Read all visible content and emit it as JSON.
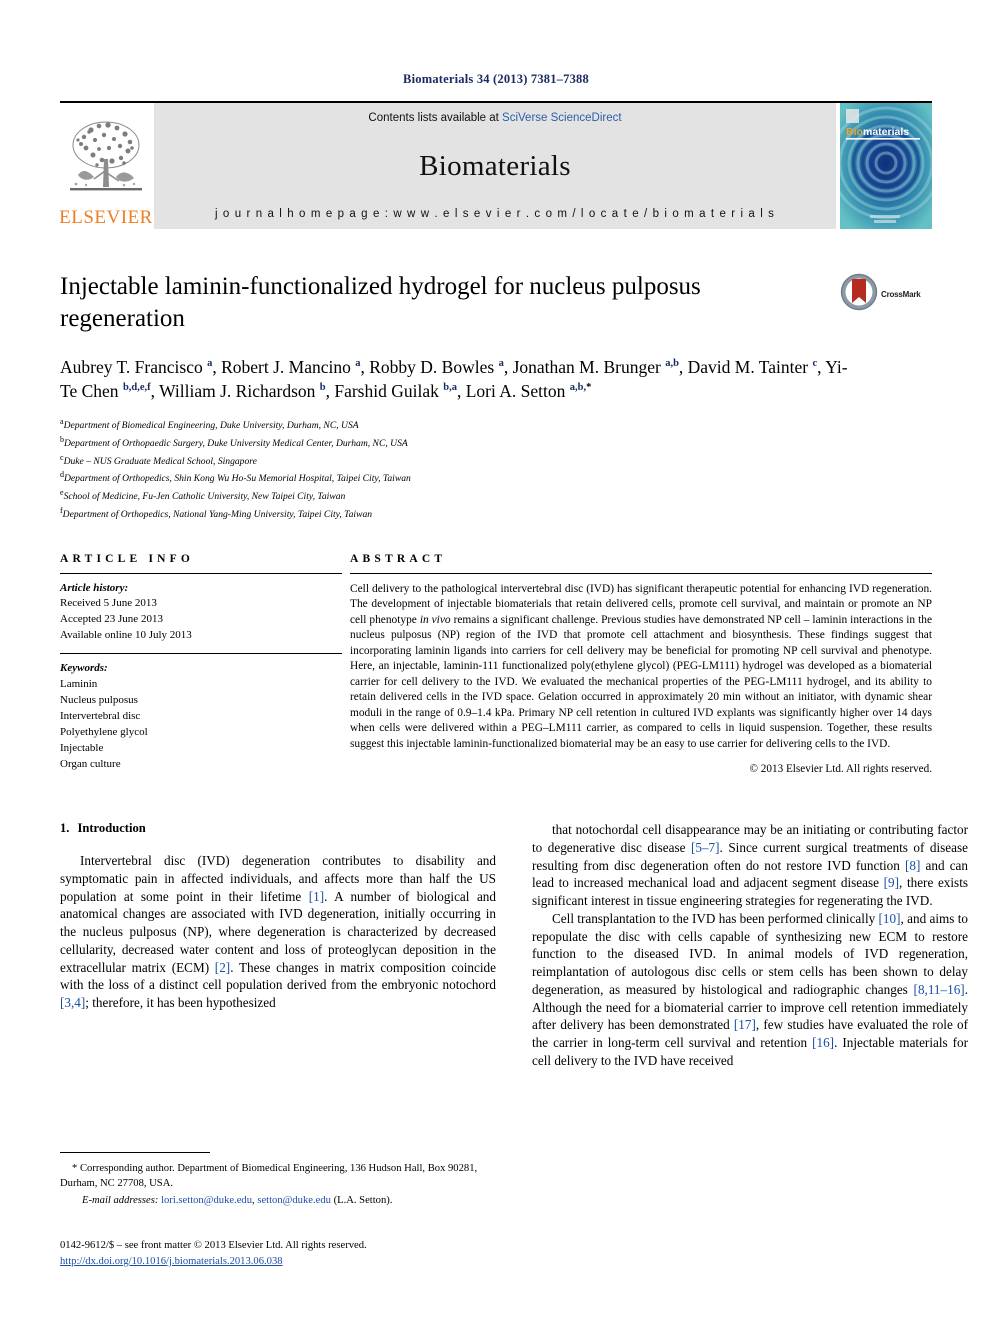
{
  "running_head": "Biomaterials 34 (2013) 7381–7388",
  "masthead": {
    "publisher_word": "ELSEVIER",
    "contents_prefix": "Contents lists available at ",
    "contents_link": "SciVerse ScienceDirect",
    "journal_title": "Biomaterials",
    "homepage": "j o u r n a l   h o m e p a g e :   w w w . e l s e v i e r . c o m / l o c a t e / b i o m a t e r i a l s",
    "cover_title_a": "Bio",
    "cover_title_b": "materials"
  },
  "article": {
    "title": "Injectable laminin-functionalized hydrogel for nucleus pulposus regeneration",
    "crossmark_label": "CrossMark",
    "authors_html": "Aubrey T. Francisco <sup>a</sup>, Robert J. Mancino <sup>a</sup>, Robby D. Bowles <sup>a</sup>, Jonathan M. Brunger <sup>a,b</sup>, David M. Tainter <sup>c</sup>, Yi-Te Chen <sup>b,d,e,f</sup>, William J. Richardson <sup>b</sup>, Farshid Guilak <sup>b,a</sup>, Lori A. Setton <sup>a,b,</sup><sup class=\"corr\">*</sup>",
    "affiliations": [
      {
        "mark": "a",
        "text": "Department of Biomedical Engineering, Duke University, Durham, NC, USA"
      },
      {
        "mark": "b",
        "text": "Department of Orthopaedic Surgery, Duke University Medical Center, Durham, NC, USA"
      },
      {
        "mark": "c",
        "text": "Duke – NUS Graduate Medical School, Singapore"
      },
      {
        "mark": "d",
        "text": "Department of Orthopedics, Shin Kong Wu Ho-Su Memorial Hospital, Taipei City, Taiwan"
      },
      {
        "mark": "e",
        "text": "School of Medicine, Fu-Jen Catholic University, New Taipei City, Taiwan"
      },
      {
        "mark": "f",
        "text": "Department of Orthopedics, National Yang-Ming University, Taipei City, Taiwan"
      }
    ]
  },
  "article_info": {
    "heading": "ARTICLE INFO",
    "history_label": "Article history:",
    "history": [
      "Received 5 June 2013",
      "Accepted 23 June 2013",
      "Available online 10 July 2013"
    ],
    "keywords_label": "Keywords:",
    "keywords": [
      "Laminin",
      "Nucleus pulposus",
      "Intervertebral disc",
      "Polyethylene glycol",
      "Injectable",
      "Organ culture"
    ]
  },
  "abstract": {
    "heading": "ABSTRACT",
    "text_html": "Cell delivery to the pathological intervertebral disc (IVD) has significant therapeutic potential for enhancing IVD regeneration. The development of injectable biomaterials that retain delivered cells, promote cell survival, and maintain or promote an NP cell phenotype <em>in vivo</em> remains a significant challenge. Previous studies have demonstrated NP cell – laminin interactions in the nucleus pulposus (NP) region of the IVD that promote cell attachment and biosynthesis. These findings suggest that incorporating laminin ligands into carriers for cell delivery may be beneficial for promoting NP cell survival and phenotype. Here, an injectable, laminin-111 functionalized poly(ethylene glycol) (PEG-LM111) hydrogel was developed as a biomaterial carrier for cell delivery to the IVD. We evaluated the mechanical properties of the PEG-LM111 hydrogel, and its ability to retain delivered cells in the IVD space. Gelation occurred in approximately 20 min without an initiator, with dynamic shear moduli in the range of 0.9–1.4 kPa. Primary NP cell retention in cultured IVD explants was significantly higher over 14 days when cells were delivered within a PEG–LM111 carrier, as compared to cells in liquid suspension. Together, these results suggest this injectable laminin-functionalized biomaterial may be an easy to use carrier for delivering cells to the IVD.",
    "copyright": "© 2013 Elsevier Ltd. All rights reserved."
  },
  "body": {
    "section_number": "1.",
    "section_title": "Introduction",
    "left_paragraph_html": "Intervertebral disc (IVD) degeneration contributes to disability and symptomatic pain in affected individuals, and affects more than half the US population at some point in their lifetime <span class=\"ref\">[1]</span>. A number of biological and anatomical changes are associated with IVD degeneration, initially occurring in the nucleus pulposus (NP), where degeneration is characterized by decreased cellularity, decreased water content and loss of proteoglycan deposition in the extracellular matrix (ECM) <span class=\"ref\">[2]</span>. These changes in matrix composition coincide with the loss of a distinct cell population derived from the embryonic notochord <span class=\"ref\">[3,4]</span>; therefore, it has been hypothesized",
    "right_paragraph_1_html": "that notochordal cell disappearance may be an initiating or contributing factor to degenerative disc disease <span class=\"ref\">[5–7]</span>. Since current surgical treatments of disease resulting from disc degeneration often do not restore IVD function <span class=\"ref\">[8]</span> and can lead to increased mechanical load and adjacent segment disease <span class=\"ref\">[9]</span>, there exists significant interest in tissue engineering strategies for regenerating the IVD.",
    "right_paragraph_2_html": "Cell transplantation to the IVD has been performed clinically <span class=\"ref\">[10]</span>, and aims to repopulate the disc with cells capable of synthesizing new ECM to restore function to the diseased IVD. In animal models of IVD regeneration, reimplantation of autologous disc cells or stem cells has been shown to delay degeneration, as measured by histological and radiographic changes <span class=\"ref\">[8,11–16]</span>. Although the need for a biomaterial carrier to improve cell retention immediately after delivery has been demonstrated <span class=\"ref\">[17]</span>, few studies have evaluated the role of the carrier in long-term cell survival and retention <span class=\"ref\">[16]</span>. Injectable materials for cell delivery to the IVD have received"
  },
  "footnotes": {
    "corresponding_html": "* Corresponding author. Department of Biomedical Engineering, 136 Hudson Hall, Box 90281, Durham, NC 27708, USA.",
    "email_html": "<span class=\"fn-italic\">E-mail addresses:</span> <span class=\"mail-link\">lori.setton@duke.edu</span>, <span class=\"mail-link\">setton@duke.edu</span> (L.A. Setton)."
  },
  "imprint": {
    "line1": "0142-9612/$ – see front matter © 2013 Elsevier Ltd. All rights reserved.",
    "doi": "http://dx.doi.org/10.1016/j.biomaterials.2013.06.038"
  },
  "colors": {
    "elsevier_orange": "#ef7d22",
    "link_blue": "#1a4ea8",
    "running_head_navy": "#1a2a63",
    "banner_gray": "#e3e3e3",
    "crossmark_red": "#b62b20"
  }
}
